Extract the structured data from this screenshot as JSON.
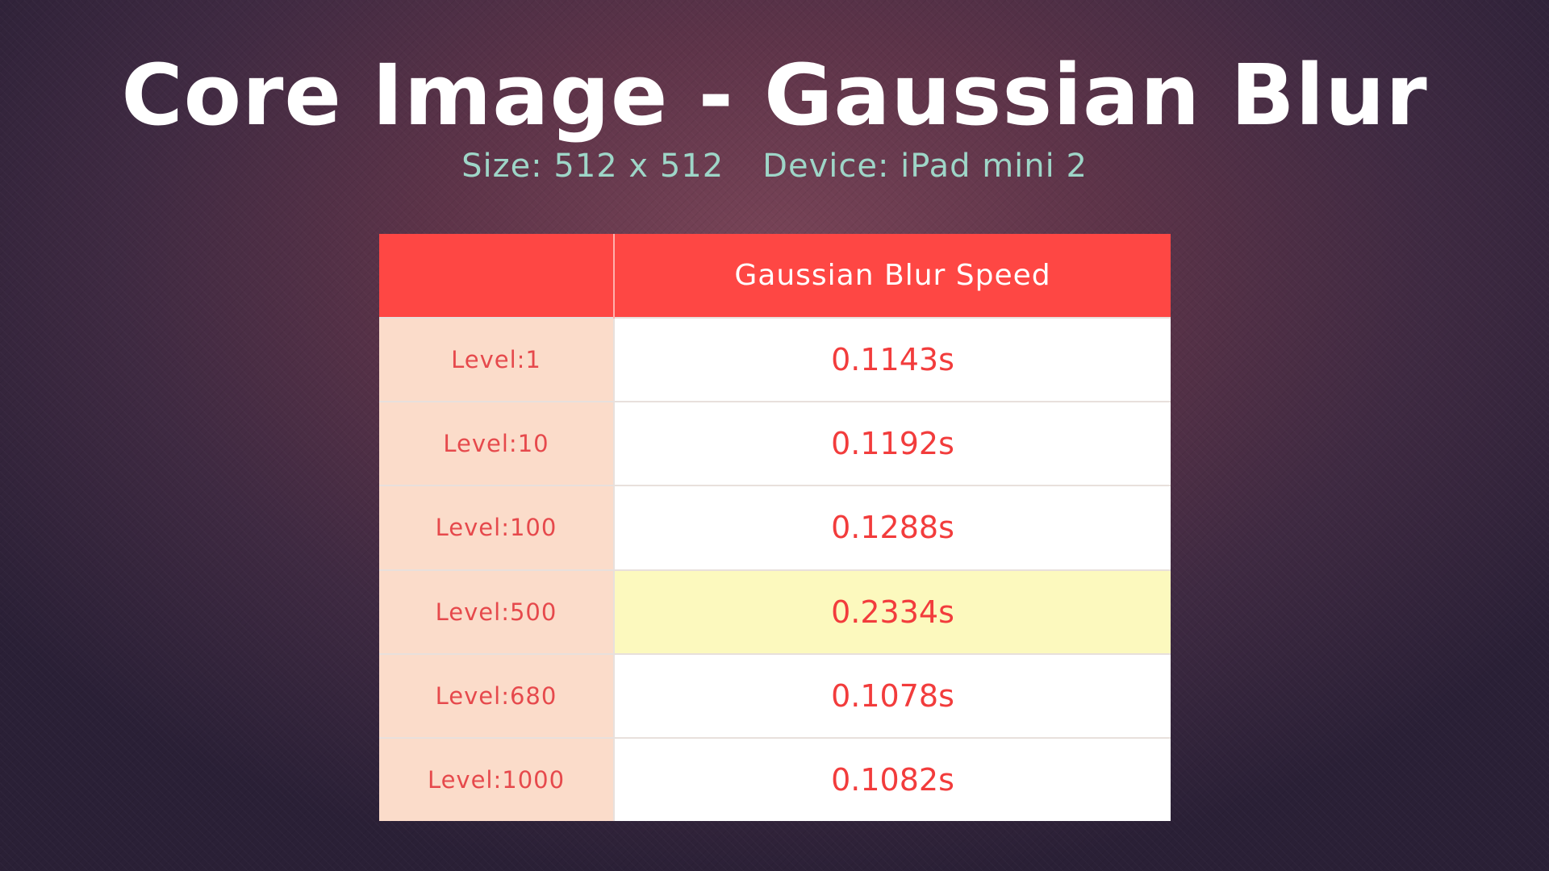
{
  "title": "Core Image - Gaussian Blur",
  "subtitle": {
    "size": "Size: 512 x 512",
    "device": "Device: iPad mini 2"
  },
  "table": {
    "corner_header": "",
    "column_header": "Gaussian Blur Speed",
    "rows": [
      {
        "label": "Level:1",
        "value": "0.1143s",
        "highlight": false
      },
      {
        "label": "Level:10",
        "value": "0.1192s",
        "highlight": false
      },
      {
        "label": "Level:100",
        "value": "0.1288s",
        "highlight": false
      },
      {
        "label": "Level:500",
        "value": "0.2334s",
        "highlight": true
      },
      {
        "label": "Level:680",
        "value": "0.1078s",
        "highlight": false
      },
      {
        "label": "Level:1000",
        "value": "0.1082s",
        "highlight": false
      }
    ]
  },
  "colors": {
    "header_bg": "#fe4744",
    "label_bg": "#fbdcca",
    "value_text": "#f23c3c",
    "highlight_bg": "#fcf9be",
    "subtitle_text": "#9ed6c8"
  }
}
